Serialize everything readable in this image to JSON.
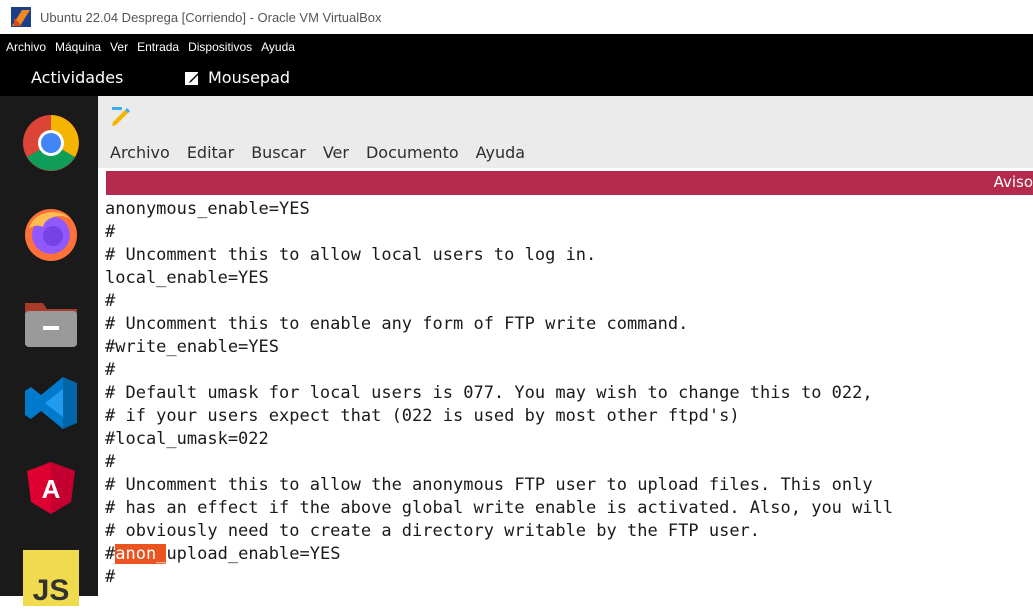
{
  "window": {
    "title": "Ubuntu 22.04 Desprega [Corriendo] - Oracle VM VirtualBox"
  },
  "vbox_menu": [
    "Archivo",
    "Máquina",
    "Ver",
    "Entrada",
    "Dispositivos",
    "Ayuda"
  ],
  "topbar": {
    "activities": "Actividades",
    "app_name": "Mousepad"
  },
  "dock": [
    "chrome-icon",
    "firefox-icon",
    "files-icon",
    "vscode-icon",
    "angular-icon",
    "javascript-icon"
  ],
  "editor": {
    "menu": [
      "Archivo",
      "Editar",
      "Buscar",
      "Ver",
      "Documento",
      "Ayuda"
    ],
    "infobar_text": "Aviso",
    "lines": [
      "anonymous_enable=YES",
      "#",
      "# Uncomment this to allow local users to log in.",
      "local_enable=YES",
      "#",
      "# Uncomment this to enable any form of FTP write command.",
      "#write_enable=YES",
      "#",
      "# Default umask for local users is 077. You may wish to change this to 022,",
      "# if your users expect that (022 is used by most other ftpd's)",
      "#local_umask=022",
      "#",
      "# Uncomment this to allow the anonymous FTP user to upload files. This only",
      "# has an effect if the above global write enable is activated. Also, you will",
      "# obviously need to create a directory writable by the FTP user."
    ],
    "highlight_line": {
      "prefix": "#",
      "highlight": "anon_",
      "suffix": "upload_enable=YES"
    },
    "last_line": "#",
    "highlight_color": "#e95420",
    "infobar_color": "#b42a4c"
  }
}
